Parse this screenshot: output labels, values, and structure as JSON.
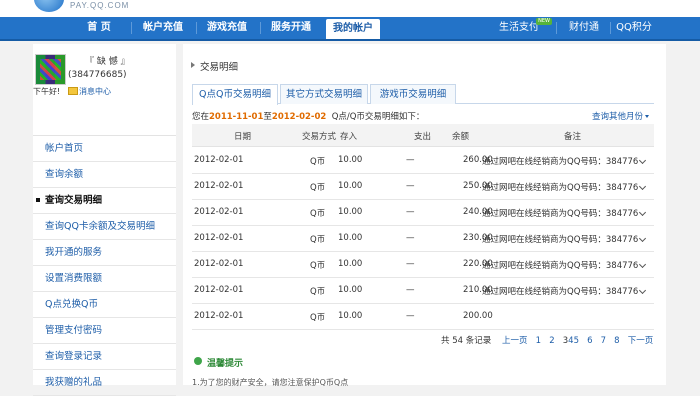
{
  "header": {
    "logo_text": "PAY.QQ.COM",
    "nav": [
      "首 页",
      "帐户充值",
      "游戏充值",
      "服务开通",
      "我的帐户"
    ],
    "nav_right": [
      "生活支付",
      "财付通",
      "QQ积分"
    ],
    "new_badge": "NEW"
  },
  "sidebar": {
    "username": "『 缺 憾 』",
    "qq": "(384776685)",
    "greeting": "下午好!",
    "message_center": "消息中心",
    "items": [
      "帐户首页",
      "查询余额",
      "查询交易明细",
      "查询QQ卡余额及交易明细",
      "我开通的服务",
      "设置消费限额",
      "Q点兑换Q币",
      "管理支付密码",
      "查询登录记录",
      "我获赠的礼品"
    ],
    "active_index": 2
  },
  "main": {
    "breadcrumb": "交易明细",
    "tabs": [
      "Q点Q币交易明细",
      "其它方式交易明细",
      "游戏币交易明细"
    ],
    "query": {
      "prefix": "您在",
      "start": "2011-11-01",
      "mid": "至",
      "end": "2012-02-02",
      "suffix": "Q点/Q币交易明细如下：",
      "other_link": "查询其他月份"
    },
    "columns": [
      "日期",
      "交易方式",
      "存入",
      "支出",
      "余额",
      "备注"
    ],
    "rows": [
      {
        "date": "2012-02-01",
        "method": "Q币",
        "deposit": "10.00",
        "expense": "—",
        "balance": "260.00",
        "remark": "通过网吧在线经销商为QQ号码：384776"
      },
      {
        "date": "2012-02-01",
        "method": "Q币",
        "deposit": "10.00",
        "expense": "—",
        "balance": "250.00",
        "remark": "通过网吧在线经销商为QQ号码：384776"
      },
      {
        "date": "2012-02-01",
        "method": "Q币",
        "deposit": "10.00",
        "expense": "—",
        "balance": "240.00",
        "remark": "通过网吧在线经销商为QQ号码：384776"
      },
      {
        "date": "2012-02-01",
        "method": "Q币",
        "deposit": "10.00",
        "expense": "—",
        "balance": "230.00",
        "remark": "通过网吧在线经销商为QQ号码：384776"
      },
      {
        "date": "2012-02-01",
        "method": "Q币",
        "deposit": "10.00",
        "expense": "—",
        "balance": "220.00",
        "remark": "通过网吧在线经销商为QQ号码：384776"
      },
      {
        "date": "2012-02-01",
        "method": "Q币",
        "deposit": "10.00",
        "expense": "—",
        "balance": "210.00",
        "remark": "通过网吧在线经销商为QQ号码：384776"
      },
      {
        "date": "2012-02-01",
        "method": "Q币",
        "deposit": "10.00",
        "expense": "—",
        "balance": "200.00",
        "remark": ""
      }
    ],
    "pager": {
      "total": "共 54 条记录",
      "prev": "上一页",
      "pages": [
        "1",
        "2",
        "3",
        "4",
        "5",
        "6",
        "7",
        "8"
      ],
      "next": "下一页"
    },
    "tip": {
      "title": "温馨提示",
      "text": "1.为了您的财产安全，请您注意保护Q币Q点"
    }
  }
}
